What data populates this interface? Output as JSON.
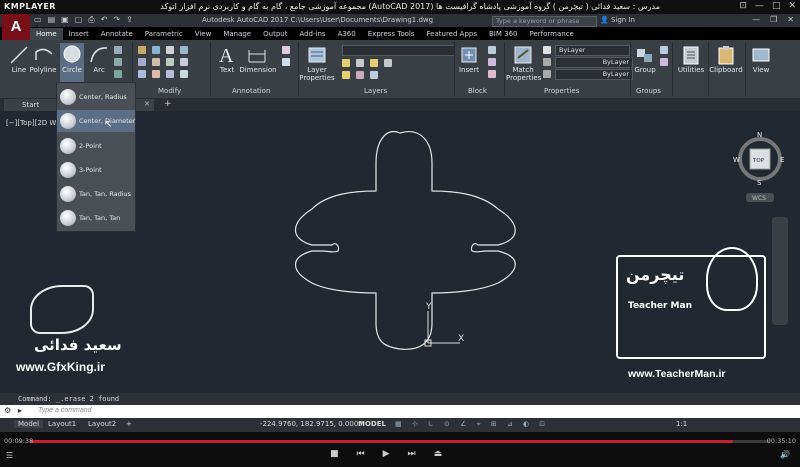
{
  "player": {
    "logo": "KMPLAYER",
    "title": "مجموعه آموزشی جامع ، گام به گام و کاربردی نرم افزار اتوکد (AutoCAD 2017) مدرس : سعید فدائی ( تیچرمن ) گروه آموزشی پادشاه گرافیست ها",
    "time_elapsed": "00:09:38",
    "time_total": "00:35:10",
    "progress": 0.95
  },
  "app": {
    "logo": "A",
    "window_title": "Autodesk AutoCAD 2017    C:\\Users\\User\\Documents\\Drawing1.dwg",
    "search_placeholder": "Type a keyword or phrase",
    "signin": "Sign In"
  },
  "tabs": [
    "Home",
    "Insert",
    "Annotate",
    "Parametric",
    "View",
    "Manage",
    "Output",
    "Add-ins",
    "A360",
    "Express Tools",
    "Featured Apps",
    "BIM 360",
    "Performance"
  ],
  "ribbon": {
    "draw_tools": {
      "line": "Line",
      "polyline": "Polyline",
      "circle": "Circle",
      "arc": "Arc"
    },
    "modify_label": "Modify",
    "text": "Text",
    "dimension": "Dimension",
    "annotation_label": "Annotation",
    "layer_properties": "Layer\nProperties",
    "layers_label": "Layers",
    "insert": "Insert",
    "block_label": "Block",
    "match_properties": "Match\nProperties",
    "properties_label": "Properties",
    "bylayer1": "ByLayer",
    "bylayer2": "ByLayer",
    "bylayer3": "ByLayer",
    "group": "Group",
    "groups_label": "Groups",
    "utilities": "Utilities",
    "clipboard": "Clipboard",
    "view": "View"
  },
  "file_tabs": {
    "start": "Start",
    "add": "+"
  },
  "viewport_label": "[−][Top][2D Wireframe]",
  "circle_flyout": [
    {
      "label": "Center, Radius"
    },
    {
      "label": "Center, Diameter"
    },
    {
      "label": "2-Point"
    },
    {
      "label": "3-Point"
    },
    {
      "label": "Tan, Tan, Radius"
    },
    {
      "label": "Tan, Tan, Tan"
    }
  ],
  "viewcube": {
    "n": "N",
    "s": "S",
    "e": "E",
    "w": "W",
    "top": "TOP",
    "wcs": "WCS"
  },
  "ucs": {
    "x": "X",
    "y": "Y"
  },
  "command": {
    "history": "Command: _.erase 2 found",
    "placeholder": "Type a command"
  },
  "layouts": [
    "Model",
    "Layout1",
    "Layout2"
  ],
  "status": {
    "coords": "-224.9760, 182.9715, 0.0000",
    "model": "MODEL",
    "scale": "1:1"
  },
  "watermarks": {
    "left_name": "سعید فدائی",
    "left_site": "www.GfxKing.ir",
    "right_site": "www.TeacherMan.ir",
    "right_brand": "تیچرمن",
    "right_en": "Teacher Man"
  },
  "colors": {
    "accent_red": "#c52030",
    "drawing_bg": "#222831",
    "ribbon_bg": "#3a3e45"
  }
}
